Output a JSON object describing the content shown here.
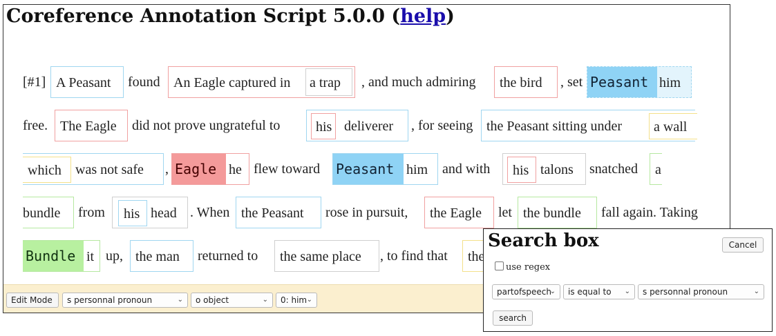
{
  "title": {
    "text": "Coreference Annotation Script 5.0.0 (",
    "help_link": "help",
    "close": ")"
  },
  "text": {
    "line1": {
      "marker": "[#1]",
      "a_peasant": "A Peasant",
      "found": "found",
      "eagle_captured_in": "An Eagle captured in",
      "a_trap": "a trap",
      "and_much_admiring": ", and much admiring",
      "the_bird": "the bird",
      "set": ", set",
      "peasant_cue": "Peasant",
      "him": "him"
    },
    "line2": {
      "free": "free.",
      "the_eagle": "The Eagle",
      "did_not": "did not prove ungrateful to",
      "his": "his",
      "deliverer": "deliverer",
      "for_seeing": ", for seeing",
      "the_peasant_sitting_under": "the Peasant sitting under",
      "a_wall": "a wall"
    },
    "line3": {
      "which": "which",
      "was_not_safe": "was not safe",
      "comma": ",",
      "eagle_cue": "Eagle",
      "he": "he",
      "flew_toward": "flew toward",
      "peasant_cue": "Peasant",
      "him": "him",
      "and_with": "and with",
      "his": "his",
      "talons": "talons",
      "snatched": "snatched",
      "a": "a"
    },
    "line4": {
      "bundle": "bundle",
      "from": "from",
      "his": "his",
      "head": "head",
      "when": ". When",
      "the_peasant": "the Peasant",
      "rose_in_pursuit": "rose in pursuit,",
      "the_eagle": "the Eagle",
      "let": "let",
      "the_bundle": "the bundle",
      "fall_again": "fall again. Taking"
    },
    "line5": {
      "bundle_cue": "Bundle",
      "it": "it",
      "up": "up,",
      "the_man": "the man",
      "returned_to": "returned to",
      "the_same_place": "the same place",
      "to_find_that": ", to find that",
      "the_partial": "the"
    }
  },
  "toolbar": {
    "edit_mode": "Edit Mode",
    "pos_select": "s personnal pronoun",
    "role_select": "o object",
    "mention_select": "0: him"
  },
  "search_box": {
    "title": "Search box",
    "cancel": "Cancel",
    "use_regex": "use regex",
    "field_select": "partofspeech",
    "op_select": "is equal to",
    "value_select": "s personnal pronoun",
    "search": "search"
  },
  "colors": {
    "cluster_blue": "#8fd3f5",
    "cluster_red": "#f49a9a",
    "cluster_green": "#b8f0a0",
    "cluster_yellow": "#f3e08a",
    "toolbar_bg": "#fbefcf",
    "link": "#1a0dab"
  },
  "icons": [
    "chevron-down-icon",
    "checkbox-icon"
  ]
}
